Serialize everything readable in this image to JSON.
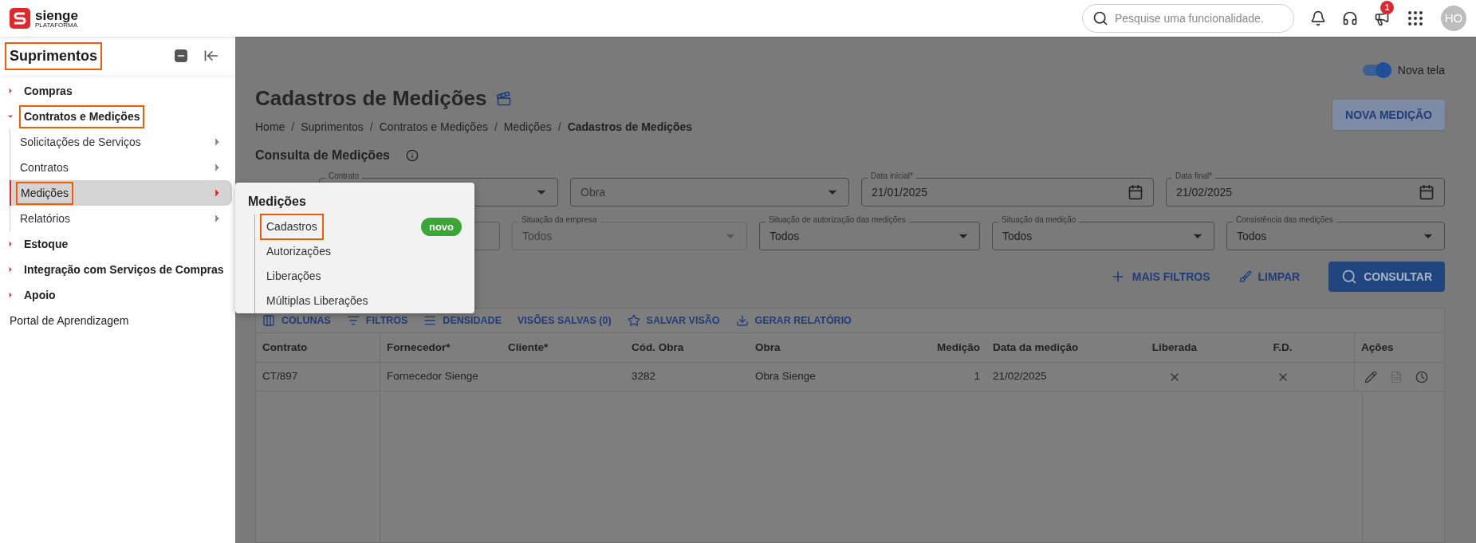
{
  "topbar": {
    "logo": {
      "name": "sienge",
      "tagline": "PLATAFORMA"
    },
    "search": {
      "placeholder": "Pesquise uma funcionalidade."
    },
    "notifications_badge": "1",
    "avatar": "HO"
  },
  "sidebar": {
    "title": "Suprimentos",
    "title_highlighted": true,
    "items": [
      {
        "label": "Compras",
        "kind": "group",
        "expanded": false,
        "highlighted": false
      },
      {
        "label": "Contratos e Medições",
        "kind": "group",
        "expanded": true,
        "highlighted": true,
        "children": [
          {
            "label": "Solicitações de Serviços",
            "selected": false,
            "highlighted": false
          },
          {
            "label": "Contratos",
            "selected": false,
            "highlighted": false
          },
          {
            "label": "Medições",
            "selected": true,
            "highlighted": true
          },
          {
            "label": "Relatórios",
            "selected": false,
            "highlighted": false
          }
        ]
      },
      {
        "label": "Estoque",
        "kind": "group",
        "expanded": false,
        "highlighted": false
      },
      {
        "label": "Integração com Serviços de Compras",
        "kind": "group",
        "expanded": false,
        "highlighted": false
      },
      {
        "label": "Apoio",
        "kind": "group",
        "expanded": false,
        "highlighted": false
      },
      {
        "label": "Portal de Aprendizagem",
        "kind": "link",
        "highlighted": false
      }
    ]
  },
  "submenu": {
    "title": "Medições",
    "items": [
      {
        "label": "Cadastros",
        "highlighted": true,
        "badge": "novo"
      },
      {
        "label": "Autorizações",
        "highlighted": false
      },
      {
        "label": "Liberações",
        "highlighted": false
      },
      {
        "label": "Múltiplas Liberações",
        "highlighted": false
      }
    ]
  },
  "page": {
    "toggle": {
      "label": "Nova tela",
      "on": true
    },
    "title": "Cadastros de Medições",
    "breadcrumb": [
      "Home",
      "Suprimentos",
      "Contratos e Medições",
      "Medições",
      "Cadastros de Medições"
    ],
    "breadcrumb_separator": "/",
    "new_button": "NOVA MEDIÇÃO",
    "section_title": "Consulta de Medições",
    "filters_row1": [
      {
        "label": "Contrato",
        "kind": "select"
      },
      {
        "placeholder": "Obra",
        "kind": "select"
      },
      {
        "label": "Data inicial*",
        "value": "21/01/2025",
        "kind": "date"
      },
      {
        "label": "Data final*",
        "value": "21/02/2025",
        "kind": "date"
      }
    ],
    "filters_row2": [
      {
        "kind": "hidden"
      },
      {
        "label": "Situação da empresa",
        "value": "Todos",
        "kind": "select",
        "disabled": true
      },
      {
        "label": "Situação de autorização das medições",
        "value": "Todos",
        "kind": "select",
        "disabled": false
      },
      {
        "label": "Situação da medição",
        "value": "Todos",
        "kind": "select",
        "disabled": false
      },
      {
        "label": "Consistência das medições",
        "value": "Todos",
        "kind": "select",
        "disabled": false
      }
    ],
    "actions": [
      "MAIS FILTROS",
      "LIMPAR",
      "CONSULTAR"
    ],
    "toolbar": [
      {
        "label": "COLUNAS",
        "kind": "columns"
      },
      {
        "label": "FILTROS",
        "kind": "filter"
      },
      {
        "label": "DENSIDADE",
        "kind": "density"
      },
      {
        "label": "VISÕES SALVAS (0)",
        "kind": "none"
      },
      {
        "label": "SALVAR VISÃO",
        "kind": "star"
      },
      {
        "label": "GERAR RELATÓRIO",
        "kind": "download"
      }
    ],
    "table": {
      "columns": [
        "Contrato",
        "Fornecedor*",
        "Cliente*",
        "Cód. Obra",
        "Obra",
        "Medição",
        "Data da medição",
        "Liberada",
        "F.D.",
        "Ações"
      ],
      "rows": [
        {
          "contrato": "CT/897",
          "fornecedor": "Fornecedor Sienge",
          "cod_obra": "3282",
          "obra": "Obra Sienge",
          "medicao": "1",
          "data": "21/02/2025",
          "liberada": false,
          "fd": false
        }
      ]
    }
  }
}
